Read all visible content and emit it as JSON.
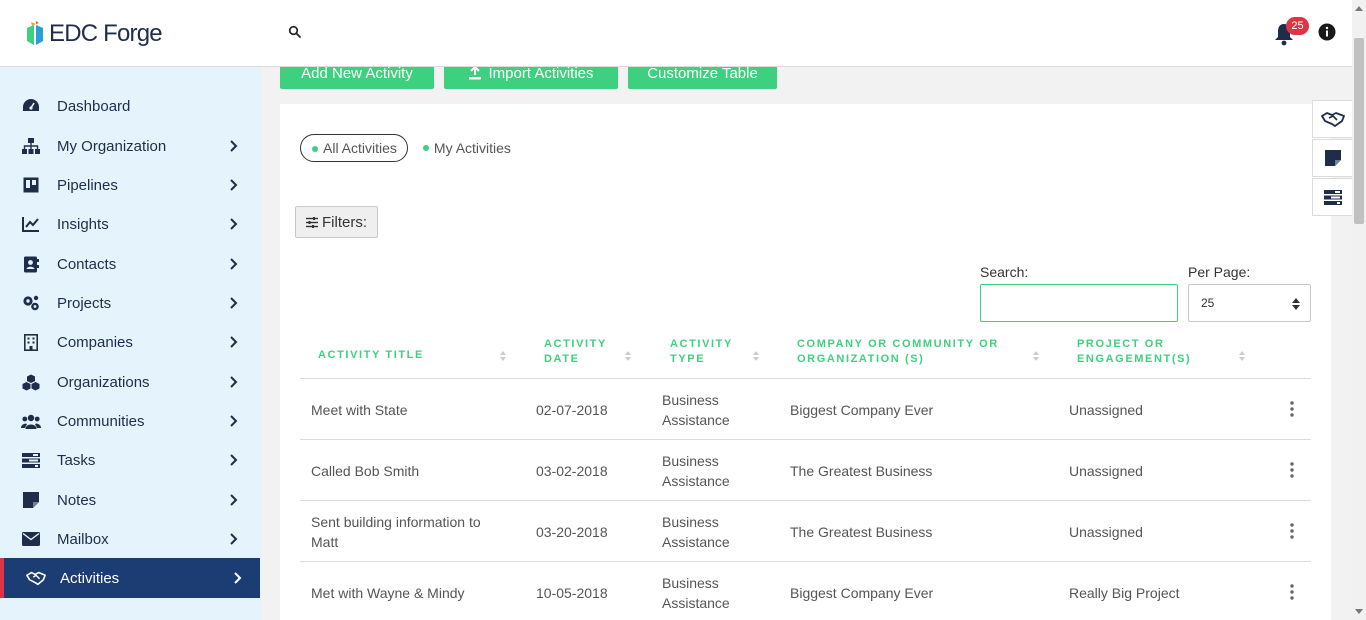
{
  "app": {
    "logo_text": "EDC Forge"
  },
  "header": {
    "notification_count": "25"
  },
  "sidebar": {
    "items": [
      {
        "label": "Dashboard",
        "icon": "dashboard-icon",
        "has_children": false
      },
      {
        "label": "My Organization",
        "icon": "sitemap-icon",
        "has_children": true
      },
      {
        "label": "Pipelines",
        "icon": "board-icon",
        "has_children": true
      },
      {
        "label": "Insights",
        "icon": "line-chart-icon",
        "has_children": true
      },
      {
        "label": "Contacts",
        "icon": "address-book-icon",
        "has_children": true
      },
      {
        "label": "Projects",
        "icon": "gears-icon",
        "has_children": true
      },
      {
        "label": "Companies",
        "icon": "building-icon",
        "has_children": true
      },
      {
        "label": "Organizations",
        "icon": "cubes-icon",
        "has_children": true
      },
      {
        "label": "Communities",
        "icon": "users-icon",
        "has_children": true
      },
      {
        "label": "Tasks",
        "icon": "tasks-icon",
        "has_children": true
      },
      {
        "label": "Notes",
        "icon": "sticky-note-icon",
        "has_children": true
      },
      {
        "label": "Mailbox",
        "icon": "envelope-icon",
        "has_children": true
      },
      {
        "label": "Activities",
        "icon": "handshake-icon",
        "has_children": true,
        "active": true
      }
    ]
  },
  "toolbar": {
    "add_label": "Add New Activity",
    "import_label": "Import Activities",
    "customize_label": "Customize Table"
  },
  "scope_toggle": {
    "all_label": "All Activities",
    "mine_label": "My Activities",
    "selected": "all"
  },
  "filters": {
    "label": "Filters:"
  },
  "search": {
    "label": "Search:",
    "value": "",
    "placeholder": ""
  },
  "per_page": {
    "label": "Per Page:",
    "value": "25"
  },
  "table": {
    "columns": [
      "Activity Title",
      "Activity Date",
      "Activity Type",
      "Company or Community or Organization (s)",
      "Project or Engagement(s)"
    ],
    "rows": [
      {
        "title": "Meet with State",
        "date": "02-07-2018",
        "type": "Business Assistance",
        "company": "Biggest Company Ever",
        "project": "Unassigned"
      },
      {
        "title": "Called Bob Smith",
        "date": "03-02-2018",
        "type": "Business Assistance",
        "company": "The Greatest Business",
        "project": "Unassigned"
      },
      {
        "title": "Sent building information to Matt",
        "date": "03-20-2018",
        "type": "Business Assistance",
        "company": "The Greatest Business",
        "project": "Unassigned"
      },
      {
        "title": "Met with Wayne & Mindy",
        "date": "10-05-2018",
        "type": "Business Assistance",
        "company": "Biggest Company Ever",
        "project": "Really Big Project"
      }
    ]
  },
  "colors": {
    "accent_green": "#3dd17f",
    "sidebar_bg": "#e4f3fc",
    "active_nav_bg": "#1c3c74",
    "badge_red": "#dc3545"
  }
}
